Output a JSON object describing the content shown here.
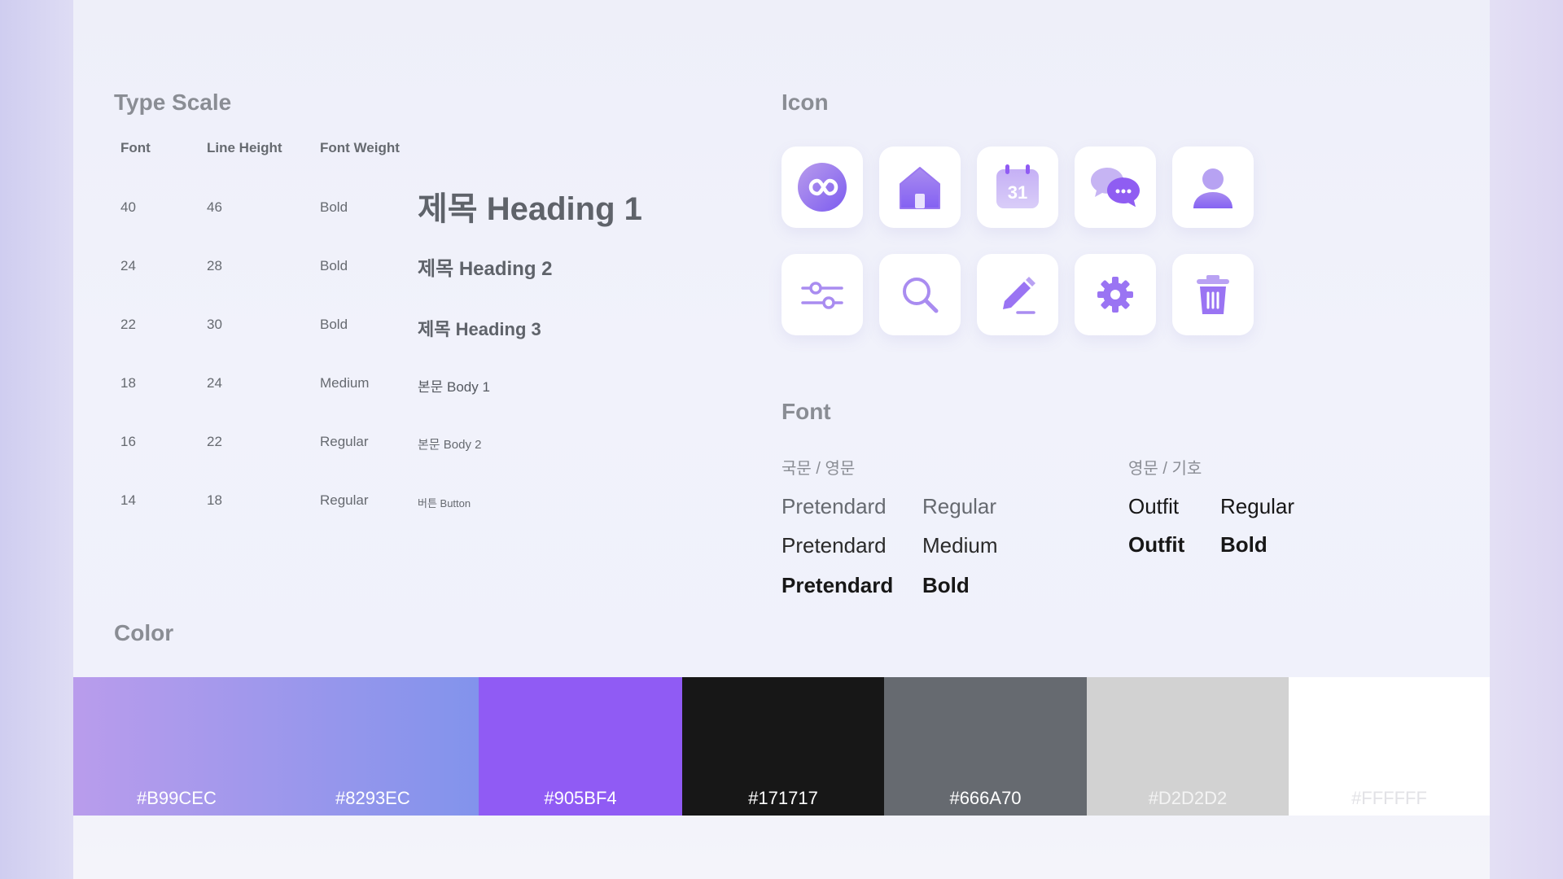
{
  "sections": {
    "type_scale": "Type Scale",
    "icon": "Icon",
    "font": "Font",
    "color": "Color"
  },
  "type_scale": {
    "headers": {
      "font": "Font",
      "line_height": "Line Height",
      "font_weight": "Font Weight"
    },
    "rows": [
      {
        "font": "40",
        "line_height": "46",
        "weight": "Bold",
        "sample": "제목 Heading 1"
      },
      {
        "font": "24",
        "line_height": "28",
        "weight": "Bold",
        "sample": "제목 Heading 2"
      },
      {
        "font": "22",
        "line_height": "30",
        "weight": "Bold",
        "sample": "제목 Heading 3"
      },
      {
        "font": "18",
        "line_height": "24",
        "weight": "Medium",
        "sample": "본문 Body 1"
      },
      {
        "font": "16",
        "line_height": "22",
        "weight": "Regular",
        "sample": "본문 Body 2"
      },
      {
        "font": "14",
        "line_height": "18",
        "weight": "Regular",
        "sample": "버튼 Button"
      }
    ]
  },
  "icons": {
    "row1": [
      "infinity-icon",
      "home-icon",
      "calendar-icon",
      "chat-icon",
      "user-icon"
    ],
    "row2": [
      "sliders-icon",
      "search-icon",
      "edit-icon",
      "settings-icon",
      "trash-icon"
    ],
    "calendar_day": "31",
    "accent": "#905BF4"
  },
  "font": {
    "korean_label": "국문 / 영문",
    "english_label": "영문 / 기호",
    "korean": [
      {
        "name": "Pretendard",
        "weight": "Regular"
      },
      {
        "name": "Pretendard",
        "weight": "Medium"
      },
      {
        "name": "Pretendard",
        "weight": "Bold"
      }
    ],
    "english": [
      {
        "name": "Outfit",
        "weight": "Regular"
      },
      {
        "name": "Outfit",
        "weight": "Bold"
      }
    ]
  },
  "colors": [
    {
      "hex": "#B99CEC"
    },
    {
      "hex": "#8293EC"
    },
    {
      "hex": "#905BF4"
    },
    {
      "hex": "#171717"
    },
    {
      "hex": "#666A70"
    },
    {
      "hex": "#D2D2D2"
    },
    {
      "hex": "#FFFFFF"
    }
  ]
}
